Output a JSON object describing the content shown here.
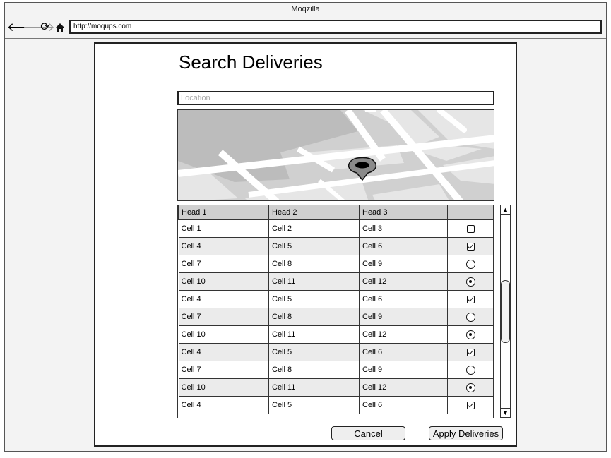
{
  "browser": {
    "title": "Moqzilla",
    "url": "http://moqups.com"
  },
  "page": {
    "title": "Search Deliveries",
    "location_placeholder": "Location"
  },
  "table": {
    "headers": [
      "Head 1",
      "Head 2",
      "Head 3",
      ""
    ],
    "rows": [
      {
        "c1": "Cell 1",
        "c2": "Cell 2",
        "c3": "Cell 3",
        "control": "checkbox",
        "checked": false
      },
      {
        "c1": "Cell 4",
        "c2": "Cell 5",
        "c3": "Cell 6",
        "control": "checkbox",
        "checked": true
      },
      {
        "c1": "Cell 7",
        "c2": "Cell 8",
        "c3": "Cell 9",
        "control": "radio",
        "checked": false
      },
      {
        "c1": "Cell 10",
        "c2": "Cell 11",
        "c3": "Cell 12",
        "control": "radio",
        "checked": true
      },
      {
        "c1": "Cell 4",
        "c2": "Cell 5",
        "c3": "Cell 6",
        "control": "checkbox",
        "checked": true
      },
      {
        "c1": "Cell 7",
        "c2": "Cell 8",
        "c3": "Cell 9",
        "control": "radio",
        "checked": false
      },
      {
        "c1": "Cell 10",
        "c2": "Cell 11",
        "c3": "Cell 12",
        "control": "radio",
        "checked": true
      },
      {
        "c1": "Cell 4",
        "c2": "Cell 5",
        "c3": "Cell 6",
        "control": "checkbox",
        "checked": true
      },
      {
        "c1": "Cell 7",
        "c2": "Cell 8",
        "c3": "Cell 9",
        "control": "radio",
        "checked": false
      },
      {
        "c1": "Cell 10",
        "c2": "Cell 11",
        "c3": "Cell 12",
        "control": "radio",
        "checked": true
      },
      {
        "c1": "Cell 4",
        "c2": "Cell 5",
        "c3": "Cell 6",
        "control": "checkbox",
        "checked": true
      }
    ]
  },
  "buttons": {
    "cancel": "Cancel",
    "apply": "Apply Deliveries"
  },
  "icons": {
    "back": "back-arrow-icon",
    "forward": "forward-arrow-icon",
    "reload": "reload-icon",
    "home": "home-icon",
    "map_pin": "map-pin-icon",
    "scroll_up": "scroll-up-icon",
    "scroll_down": "scroll-down-icon"
  }
}
